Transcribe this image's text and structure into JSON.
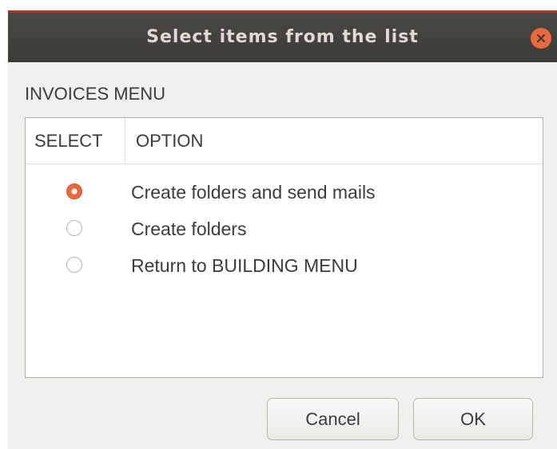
{
  "colors": {
    "accent": "#c2301a",
    "close": "#e9683c",
    "radio_selected": "#e9683c"
  },
  "window": {
    "title": "Select items from the list",
    "close_icon": "close-icon"
  },
  "menu": {
    "label": "INVOICES MENU"
  },
  "table": {
    "headers": [
      "SELECT",
      "OPTION"
    ],
    "rows": [
      {
        "option": "Create folders and send mails",
        "selected": true
      },
      {
        "option": "Create folders",
        "selected": false
      },
      {
        "option": "Return to BUILDING MENU",
        "selected": false
      }
    ]
  },
  "buttons": {
    "cancel": "Cancel",
    "ok": "OK"
  }
}
